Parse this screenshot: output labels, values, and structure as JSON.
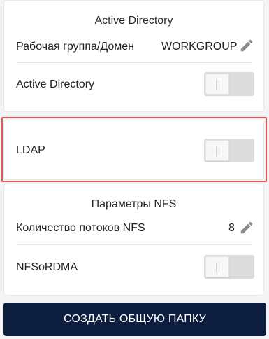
{
  "active_directory_section": {
    "title": "Active Directory",
    "workgroup_label": "Рабочая группа/Домен",
    "workgroup_value": "WORKGROUP",
    "ad_toggle_label": "Active Directory",
    "ad_enabled": false
  },
  "ldap_section": {
    "label": "LDAP",
    "enabled": false
  },
  "nfs_section": {
    "title": "Параметры NFS",
    "threads_label": "Количество потоков NFS",
    "threads_value": "8",
    "rdma_label": "NFSoRDMA",
    "rdma_enabled": false
  },
  "actions": {
    "create_button": "СОЗДАТЬ ОБЩУЮ ПАПКУ"
  },
  "colors": {
    "button_bg": "#0d1d3d",
    "highlight": "#e05555",
    "toggle_off": "#dcdcdc"
  }
}
